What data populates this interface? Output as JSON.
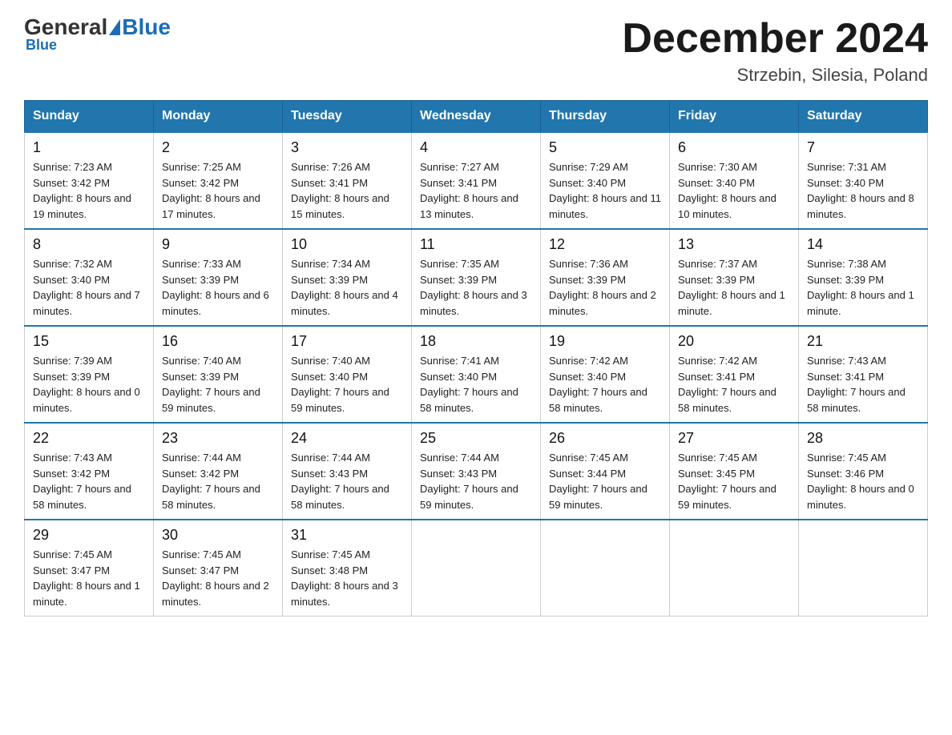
{
  "header": {
    "logo_general": "General",
    "logo_blue": "Blue",
    "title": "December 2024",
    "location": "Strzebin, Silesia, Poland"
  },
  "days_of_week": [
    "Sunday",
    "Monday",
    "Tuesday",
    "Wednesday",
    "Thursday",
    "Friday",
    "Saturday"
  ],
  "weeks": [
    [
      {
        "day": "1",
        "sunrise": "7:23 AM",
        "sunset": "3:42 PM",
        "daylight": "8 hours and 19 minutes."
      },
      {
        "day": "2",
        "sunrise": "7:25 AM",
        "sunset": "3:42 PM",
        "daylight": "8 hours and 17 minutes."
      },
      {
        "day": "3",
        "sunrise": "7:26 AM",
        "sunset": "3:41 PM",
        "daylight": "8 hours and 15 minutes."
      },
      {
        "day": "4",
        "sunrise": "7:27 AM",
        "sunset": "3:41 PM",
        "daylight": "8 hours and 13 minutes."
      },
      {
        "day": "5",
        "sunrise": "7:29 AM",
        "sunset": "3:40 PM",
        "daylight": "8 hours and 11 minutes."
      },
      {
        "day": "6",
        "sunrise": "7:30 AM",
        "sunset": "3:40 PM",
        "daylight": "8 hours and 10 minutes."
      },
      {
        "day": "7",
        "sunrise": "7:31 AM",
        "sunset": "3:40 PM",
        "daylight": "8 hours and 8 minutes."
      }
    ],
    [
      {
        "day": "8",
        "sunrise": "7:32 AM",
        "sunset": "3:40 PM",
        "daylight": "8 hours and 7 minutes."
      },
      {
        "day": "9",
        "sunrise": "7:33 AM",
        "sunset": "3:39 PM",
        "daylight": "8 hours and 6 minutes."
      },
      {
        "day": "10",
        "sunrise": "7:34 AM",
        "sunset": "3:39 PM",
        "daylight": "8 hours and 4 minutes."
      },
      {
        "day": "11",
        "sunrise": "7:35 AM",
        "sunset": "3:39 PM",
        "daylight": "8 hours and 3 minutes."
      },
      {
        "day": "12",
        "sunrise": "7:36 AM",
        "sunset": "3:39 PM",
        "daylight": "8 hours and 2 minutes."
      },
      {
        "day": "13",
        "sunrise": "7:37 AM",
        "sunset": "3:39 PM",
        "daylight": "8 hours and 1 minute."
      },
      {
        "day": "14",
        "sunrise": "7:38 AM",
        "sunset": "3:39 PM",
        "daylight": "8 hours and 1 minute."
      }
    ],
    [
      {
        "day": "15",
        "sunrise": "7:39 AM",
        "sunset": "3:39 PM",
        "daylight": "8 hours and 0 minutes."
      },
      {
        "day": "16",
        "sunrise": "7:40 AM",
        "sunset": "3:39 PM",
        "daylight": "7 hours and 59 minutes."
      },
      {
        "day": "17",
        "sunrise": "7:40 AM",
        "sunset": "3:40 PM",
        "daylight": "7 hours and 59 minutes."
      },
      {
        "day": "18",
        "sunrise": "7:41 AM",
        "sunset": "3:40 PM",
        "daylight": "7 hours and 58 minutes."
      },
      {
        "day": "19",
        "sunrise": "7:42 AM",
        "sunset": "3:40 PM",
        "daylight": "7 hours and 58 minutes."
      },
      {
        "day": "20",
        "sunrise": "7:42 AM",
        "sunset": "3:41 PM",
        "daylight": "7 hours and 58 minutes."
      },
      {
        "day": "21",
        "sunrise": "7:43 AM",
        "sunset": "3:41 PM",
        "daylight": "7 hours and 58 minutes."
      }
    ],
    [
      {
        "day": "22",
        "sunrise": "7:43 AM",
        "sunset": "3:42 PM",
        "daylight": "7 hours and 58 minutes."
      },
      {
        "day": "23",
        "sunrise": "7:44 AM",
        "sunset": "3:42 PM",
        "daylight": "7 hours and 58 minutes."
      },
      {
        "day": "24",
        "sunrise": "7:44 AM",
        "sunset": "3:43 PM",
        "daylight": "7 hours and 58 minutes."
      },
      {
        "day": "25",
        "sunrise": "7:44 AM",
        "sunset": "3:43 PM",
        "daylight": "7 hours and 59 minutes."
      },
      {
        "day": "26",
        "sunrise": "7:45 AM",
        "sunset": "3:44 PM",
        "daylight": "7 hours and 59 minutes."
      },
      {
        "day": "27",
        "sunrise": "7:45 AM",
        "sunset": "3:45 PM",
        "daylight": "7 hours and 59 minutes."
      },
      {
        "day": "28",
        "sunrise": "7:45 AM",
        "sunset": "3:46 PM",
        "daylight": "8 hours and 0 minutes."
      }
    ],
    [
      {
        "day": "29",
        "sunrise": "7:45 AM",
        "sunset": "3:47 PM",
        "daylight": "8 hours and 1 minute."
      },
      {
        "day": "30",
        "sunrise": "7:45 AM",
        "sunset": "3:47 PM",
        "daylight": "8 hours and 2 minutes."
      },
      {
        "day": "31",
        "sunrise": "7:45 AM",
        "sunset": "3:48 PM",
        "daylight": "8 hours and 3 minutes."
      },
      null,
      null,
      null,
      null
    ]
  ],
  "labels": {
    "sunrise": "Sunrise:",
    "sunset": "Sunset:",
    "daylight": "Daylight:"
  }
}
